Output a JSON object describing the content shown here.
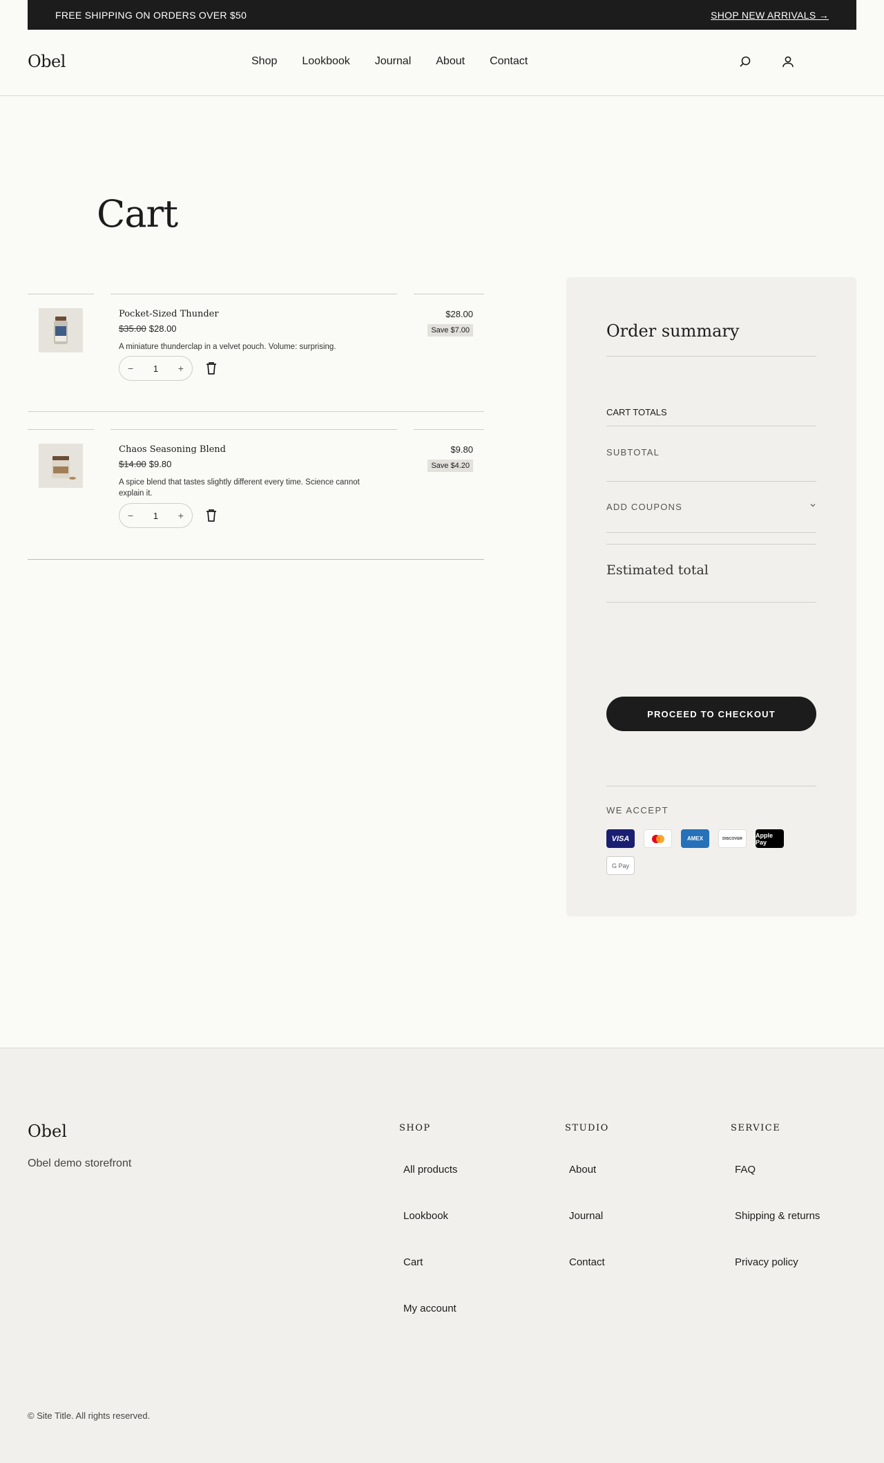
{
  "announcement": {
    "left": "FREE SHIPPING ON ORDERS OVER $50",
    "cta": "SHOP NEW ARRIVALS →"
  },
  "header": {
    "logo": "Obel",
    "nav": [
      "Shop",
      "Lookbook",
      "Journal",
      "About",
      "Contact"
    ]
  },
  "page": {
    "title": "Cart"
  },
  "cart": {
    "items": [
      {
        "name": "Pocket-Sized Thunder",
        "old_price": "$35.00",
        "price": "$28.00",
        "description": "A miniature thunderclap in a velvet pouch. Volume: surprising.",
        "qty": "1",
        "line_total": "$28.00",
        "save": "Save $7.00"
      },
      {
        "name": "Chaos Seasoning Blend",
        "old_price": "$14.00",
        "price": "$9.80",
        "description": "A spice blend that tastes slightly different every time. Science cannot explain it.",
        "qty": "1",
        "line_total": "$9.80",
        "save": "Save $4.20"
      }
    ],
    "qty_minus": "−",
    "qty_plus": "+"
  },
  "summary": {
    "title": "Order summary",
    "cart_totals": "CART TOTALS",
    "subtotal": "SUBTOTAL",
    "add_coupons": "ADD COUPONS",
    "estimated_total": "Estimated total",
    "checkout": "PROCEED TO CHECKOUT",
    "we_accept": "WE ACCEPT",
    "payment_methods": [
      "VISA",
      "Mastercard",
      "AMEX",
      "DISCOVER",
      "Apple Pay",
      "G Pay"
    ]
  },
  "footer": {
    "logo": "Obel",
    "tagline": "Obel demo storefront",
    "columns": [
      {
        "title": "SHOP",
        "links": [
          "All products",
          "Lookbook",
          "Cart",
          "My account"
        ]
      },
      {
        "title": "STUDIO",
        "links": [
          "About",
          "Journal",
          "Contact"
        ]
      },
      {
        "title": "SERVICE",
        "links": [
          "FAQ",
          "Shipping & returns",
          "Privacy policy"
        ]
      }
    ],
    "copyright": "© Site Title. All rights reserved."
  },
  "colors": {
    "ink": "#1c1c1c",
    "background": "#fafaf6",
    "panel": "#f2f0ec"
  }
}
